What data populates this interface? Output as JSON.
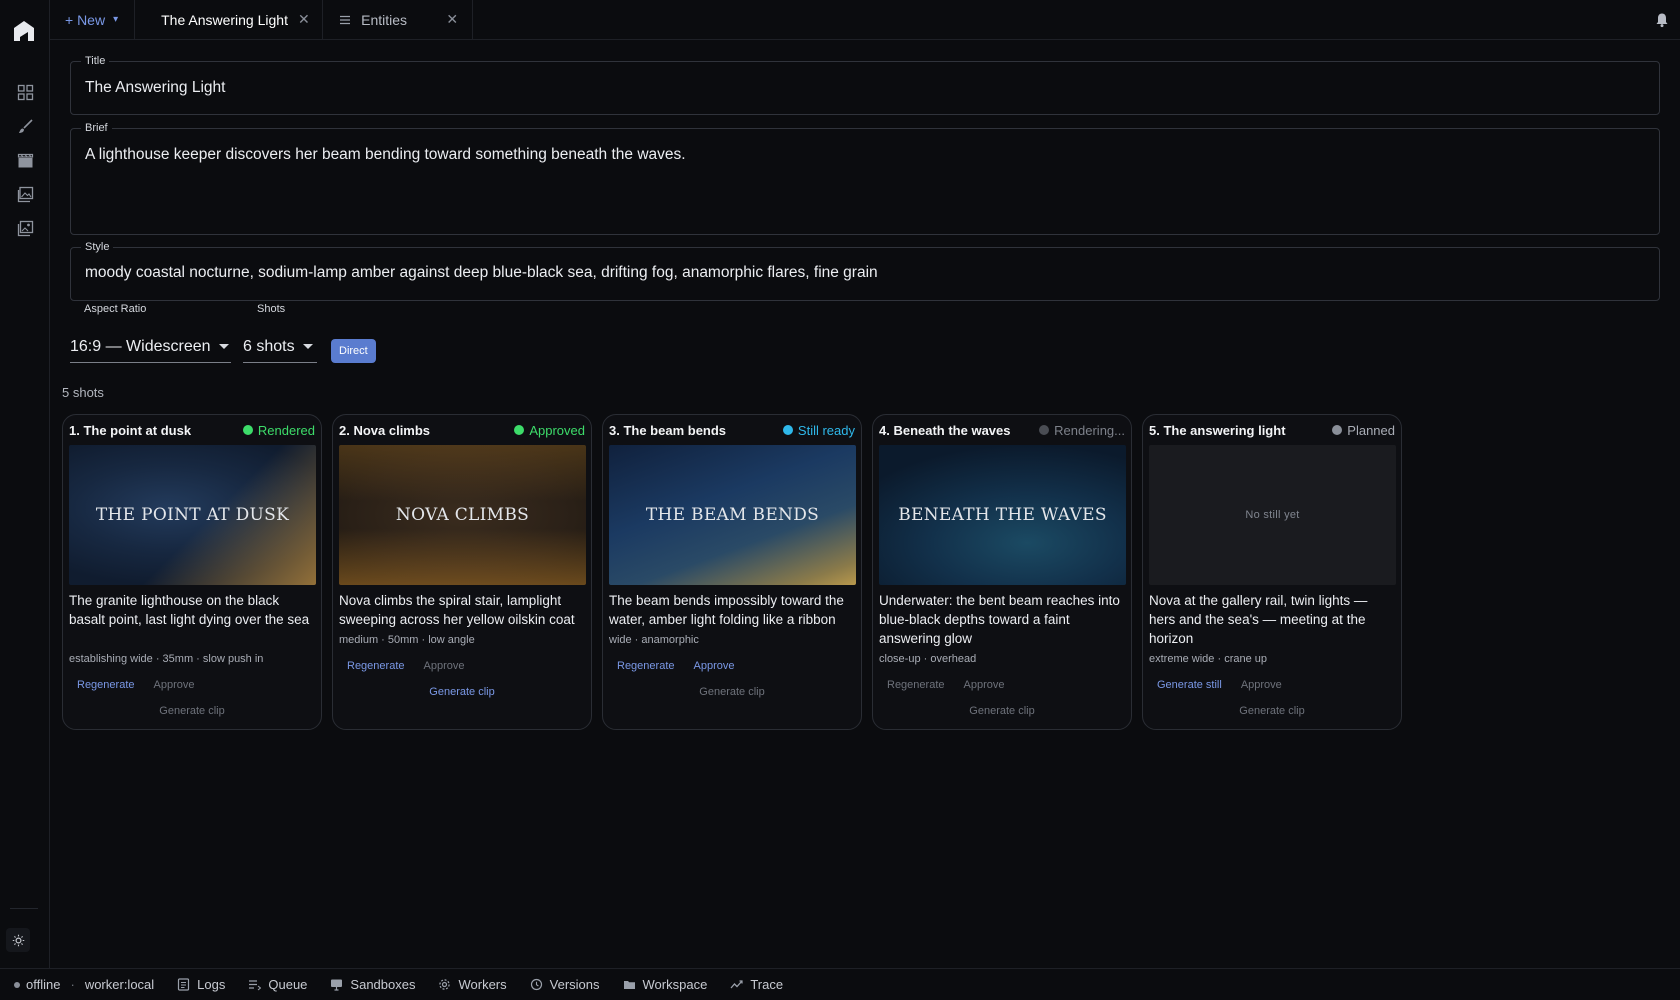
{
  "tabs": {
    "new_label": "+ New",
    "items": [
      {
        "label": "The Answering Light",
        "active": true
      },
      {
        "label": "Entities",
        "active": false
      }
    ]
  },
  "form": {
    "title_label": "Title",
    "title_value": "The Answering Light",
    "brief_label": "Brief",
    "brief_value": "A lighthouse keeper discovers her beam bending toward something beneath the waves.",
    "style_label": "Style",
    "style_value": "moody coastal nocturne, sodium-lamp amber against deep blue-black sea, drifting fog, anamorphic flares, fine grain",
    "aspect_label": "Aspect Ratio",
    "aspect_value": "16:9 — Widescreen",
    "shots_label": "Shots",
    "shots_value": "6 shots",
    "direct_label": "Direct"
  },
  "shots": {
    "count_label": "5 shots",
    "items": [
      {
        "title": "1. The point at dusk",
        "status": "Rendered",
        "status_color": "#3ddc6a",
        "still_text": "THE POINT AT DUSK",
        "description": "The granite lighthouse on the black basalt point, last light dying over the sea",
        "meta": "establishing wide · 35mm · slow push in",
        "action1": "Regenerate",
        "action2": "Approve",
        "clip": "Generate clip"
      },
      {
        "title": "2. Nova climbs",
        "status": "Approved",
        "status_color": "#3ddc6a",
        "still_text": "NOVA CLIMBS",
        "description": "Nova climbs the spiral stair, lamplight sweeping across her yellow oilskin coat",
        "meta": "medium · 50mm · low angle",
        "action1": "Regenerate",
        "action2": "Approve",
        "clip": "Generate clip"
      },
      {
        "title": "3. The beam bends",
        "status": "Still ready",
        "status_color": "#2fb8ea",
        "still_text": "THE BEAM BENDS",
        "description": "The beam bends impossibly toward the water, amber light folding like a ribbon",
        "meta": "wide · anamorphic",
        "action1": "Regenerate",
        "action2": "Approve",
        "clip": "Generate clip"
      },
      {
        "title": "4. Beneath the waves",
        "status": "Rendering...",
        "status_color": "#4a4d54",
        "still_text": "BENEATH THE WAVES",
        "description": "Underwater: the bent beam reaches into blue-black depths toward a faint answering glow",
        "meta": "close-up · overhead",
        "action1": "Regenerate",
        "action2": "Approve",
        "clip": "Generate clip"
      },
      {
        "title": "5. The answering light",
        "status": "Planned",
        "status_color": "#8a8f99",
        "still_text": "No still yet",
        "description": "Nova at the gallery rail, twin lights — hers and the sea's — meeting at the horizon",
        "meta": "extreme wide · crane up",
        "action1": "Generate still",
        "action2": "Approve",
        "clip": "Generate clip"
      }
    ]
  },
  "statusbar": {
    "connection": "offline",
    "worker": "worker:local",
    "items": [
      "Logs",
      "Queue",
      "Sandboxes",
      "Workers",
      "Versions",
      "Workspace",
      "Trace"
    ]
  },
  "icons": {
    "rail": [
      "grid-icon",
      "brush-icon",
      "clapper-icon",
      "images-icon",
      "gallery-icon"
    ],
    "accent": "#7a98e6"
  }
}
